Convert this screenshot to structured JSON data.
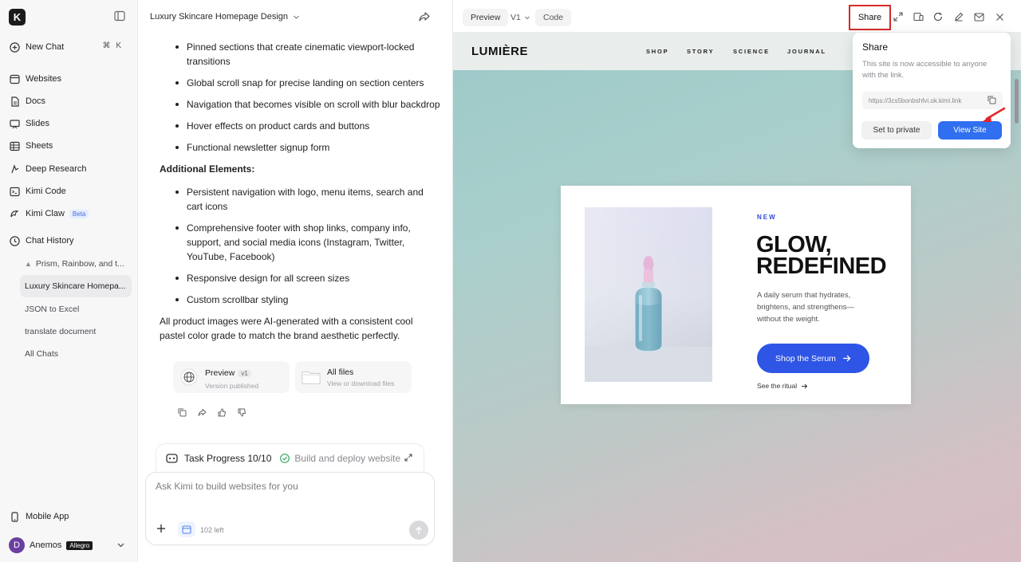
{
  "sidebar": {
    "logo_letter": "K",
    "new_chat": {
      "label": "New Chat",
      "shortcut": "⌘ K"
    },
    "nav": [
      {
        "label": "Websites",
        "icon": "browser-icon"
      },
      {
        "label": "Docs",
        "icon": "document-icon"
      },
      {
        "label": "Slides",
        "icon": "slides-icon"
      },
      {
        "label": "Sheets",
        "icon": "table-icon"
      },
      {
        "label": "Deep Research",
        "icon": "research-icon"
      },
      {
        "label": "Kimi Code",
        "icon": "terminal-icon"
      },
      {
        "label": "Kimi Claw",
        "icon": "claw-icon",
        "badge": "Beta"
      }
    ],
    "history_label": "Chat History",
    "history": [
      {
        "label": "Prism, Rainbow, and t...",
        "pinned": true
      },
      {
        "label": "Luxury Skincare Homepa...",
        "active": true
      },
      {
        "label": "JSON to Excel"
      },
      {
        "label": "translate document"
      },
      {
        "label": "All Chats"
      }
    ],
    "mobile_app": "Mobile App",
    "user": {
      "initial": "D",
      "name": "Anemos",
      "plan": "Allegro"
    }
  },
  "chat": {
    "title": "Luxury Skincare Homepage Design",
    "bullets_1": [
      "Pinned sections that create cinematic viewport-locked transitions",
      "Global scroll snap for precise landing on section centers",
      "Navigation that becomes visible on scroll with blur backdrop",
      "Hover effects on product cards and buttons",
      "Functional newsletter signup form"
    ],
    "section_title": "Additional Elements:",
    "bullets_2": [
      "Persistent navigation with logo, menu items, search and cart icons",
      "Comprehensive footer with shop links, company info, support, and social media icons (Instagram, Twitter, YouTube, Facebook)",
      "Responsive design for all screen sizes",
      "Custom scrollbar styling"
    ],
    "closing": "All product images were AI-generated with a consistent cool pastel color grade to match the brand aesthetic perfectly.",
    "cards": {
      "preview": {
        "title": "Preview",
        "version": "v1",
        "subtitle": "Version published"
      },
      "files": {
        "title": "All files",
        "subtitle": "View or download files"
      }
    },
    "task": {
      "label": "Task Progress 10/10",
      "status": "Build and deploy website"
    },
    "composer": {
      "placeholder": "Ask Kimi to build websites for you",
      "remaining": "102 left"
    }
  },
  "preview": {
    "tabs": {
      "preview": "Preview",
      "version": "V1",
      "code": "Code"
    },
    "share_label": "Share",
    "site": {
      "brand": "LUMIÈRE",
      "nav": [
        "SHOP",
        "STORY",
        "SCIENCE",
        "JOURNAL"
      ],
      "hero": {
        "eyebrow": "NEW",
        "title_line1": "GLOW,",
        "title_line2": "REDEFINED",
        "description": "A daily serum that hydrates, brightens, and strengthens—without the weight.",
        "cta": "Shop the Serum",
        "link": "See the ritual"
      }
    },
    "share_popover": {
      "title": "Share",
      "description": "This site is now accessible to anyone with the link.",
      "url": "https://3cs5bonbshfvi.ok.kimi.link",
      "private_button": "Set to private",
      "view_button": "View Site"
    }
  },
  "colors": {
    "accent": "#2f6ff0",
    "cta": "#2e55e6",
    "highlight": "#d42a2a",
    "eyebrow": "#2f4ad6"
  }
}
